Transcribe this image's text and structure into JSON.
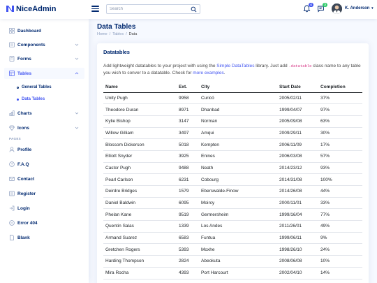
{
  "header": {
    "app_name": "NiceAdmin",
    "search_placeholder": "Search",
    "notifications_count": "4",
    "messages_count": "3",
    "profile_name": "K. Anderson"
  },
  "sidebar": {
    "items": [
      {
        "label": "Dashboard",
        "icon": "grid-icon"
      },
      {
        "label": "Components",
        "icon": "menu-icon"
      },
      {
        "label": "Forms",
        "icon": "journal-icon"
      },
      {
        "label": "Tables",
        "icon": "layout-icon"
      },
      {
        "label": "Charts",
        "icon": "bar-chart-icon"
      },
      {
        "label": "Icons",
        "icon": "gem-icon"
      }
    ],
    "sub_items": [
      "General Tables",
      "Data Tables"
    ],
    "pages_heading": "PAGES",
    "pages": [
      {
        "label": "Profile",
        "icon": "person-icon"
      },
      {
        "label": "F.A.Q",
        "icon": "question-icon"
      },
      {
        "label": "Contact",
        "icon": "envelope-icon"
      },
      {
        "label": "Register",
        "icon": "card-list-icon"
      },
      {
        "label": "Login",
        "icon": "login-icon"
      },
      {
        "label": "Error 404",
        "icon": "dash-circle-icon"
      },
      {
        "label": "Blank",
        "icon": "file-icon"
      }
    ]
  },
  "page": {
    "title": "Data Tables",
    "breadcrumb": [
      "Home",
      "/",
      "Tables",
      "/",
      "Data"
    ]
  },
  "card": {
    "title": "Datatables",
    "text_1": "Add lightweight datatables to your project with using the ",
    "link_1": "Simple DataTables",
    "text_2": " library. Just add ",
    "code": ".datatable",
    "text_3": " class name to any table you wish to conver to a datatable. Check for ",
    "link_2": "more examples",
    "text_4": "."
  },
  "table": {
    "headers": [
      "Name",
      "Ext.",
      "City",
      "Start Date",
      "Completion"
    ],
    "rows": [
      [
        "Unity Pugh",
        "9958",
        "Curicó",
        "2005/02/11",
        "37%"
      ],
      [
        "Theodore Duran",
        "8971",
        "Dhanbad",
        "1999/04/07",
        "97%"
      ],
      [
        "Kylie Bishop",
        "3147",
        "Norman",
        "2005/09/08",
        "63%"
      ],
      [
        "Willow Gilliam",
        "3497",
        "Amqui",
        "2009/29/11",
        "30%"
      ],
      [
        "Blossom Dickerson",
        "5018",
        "Kempten",
        "2006/11/09",
        "17%"
      ],
      [
        "Elliott Snyder",
        "3925",
        "Enines",
        "2006/03/08",
        "57%"
      ],
      [
        "Castor Pugh",
        "9488",
        "Neath",
        "2014/23/12",
        "93%"
      ],
      [
        "Pearl Carlson",
        "6231",
        "Cobourg",
        "2014/31/08",
        "100%"
      ],
      [
        "Deirdre Bridges",
        "1579",
        "Eberswalde-Finow",
        "2014/26/08",
        "44%"
      ],
      [
        "Daniel Baldwin",
        "6095",
        "Moircy",
        "2000/11/01",
        "33%"
      ],
      [
        "Phelan Kane",
        "9519",
        "Germersheim",
        "1999/16/04",
        "77%"
      ],
      [
        "Quentin Salas",
        "1339",
        "Los Andes",
        "2011/26/01",
        "49%"
      ],
      [
        "Armand Suarez",
        "6583",
        "Funtua",
        "1999/06/11",
        "9%"
      ],
      [
        "Gretchen Rogers",
        "5393",
        "Moxhe",
        "1998/26/10",
        "24%"
      ],
      [
        "Harding Thompson",
        "2824",
        "Abeokuta",
        "2008/06/08",
        "10%"
      ],
      [
        "Mira Rocha",
        "4393",
        "Port Harcourt",
        "2002/04/10",
        "14%"
      ]
    ]
  },
  "colors": {
    "primary": "#4154f1",
    "navy": "#012970",
    "bell_badge": "#4154f1",
    "chat_badge": "#2eca6a"
  }
}
